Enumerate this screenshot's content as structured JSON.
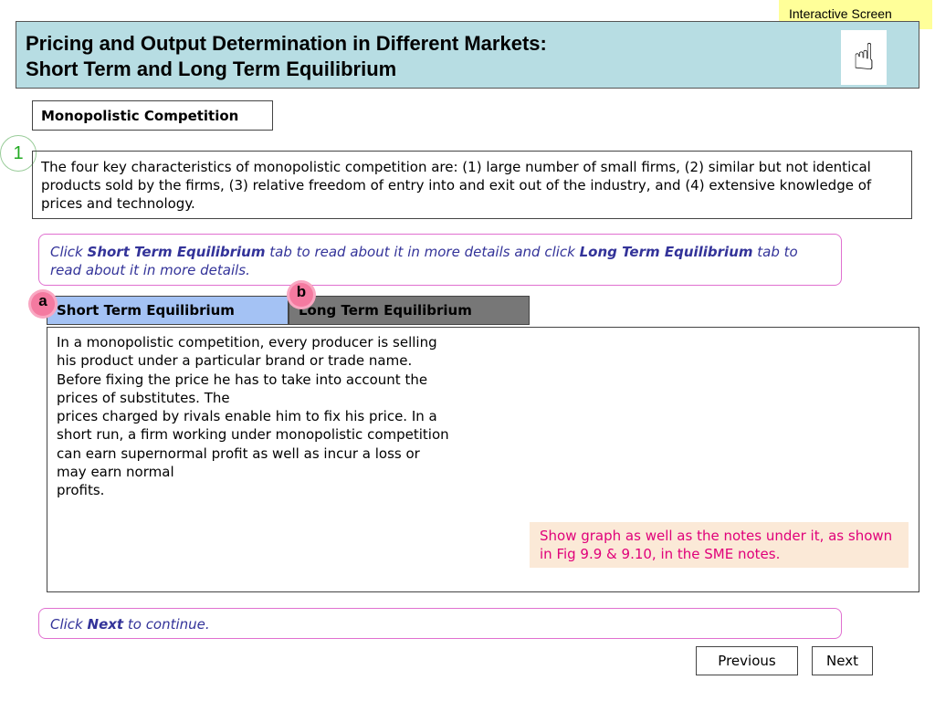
{
  "badge": "Interactive Screen",
  "header": {
    "line1": "Pricing and Output Determination in Different Markets:",
    "line2": "Short Term and Long Term Equilibrium"
  },
  "section_title": "Monopolistic Competition",
  "step_number": "1",
  "intro": "The four key characteristics of monopolistic competition are: (1) large number of small firms, (2) similar but not identical products sold by the firms, (3) relative freedom of entry into and exit out of the industry, and (4) extensive knowledge of prices and technology.",
  "instruction": {
    "p1": "Click ",
    "b1": "Short Term Equilibrium",
    "p2": " tab to read about it in more details and click ",
    "b2": "Long Term Equilibrium",
    "p3": " tab to read about it in more details."
  },
  "tabs": [
    {
      "marker": "a",
      "label": "Short Term Equilibrium"
    },
    {
      "marker": "b",
      "label": "Long Term Equilibrium"
    }
  ],
  "content": "In a monopolistic competition, every producer is selling his product under a particular brand or trade name. Before fixing the price he has to take into account the prices of substitutes. The\n prices charged by rivals enable him to fix his price. In a short run, a firm working under monopolistic competition can earn supernormal profit as well as incur a loss or may earn normal\n profits.",
  "dev_note": "Show graph as well as the notes under it, as shown in Fig 9.9 & 9.10, in the SME notes.",
  "next_note": {
    "p1": "Click ",
    "b1": "Next",
    "p2": " to continue."
  },
  "buttons": {
    "previous": "Previous",
    "next": "Next"
  }
}
